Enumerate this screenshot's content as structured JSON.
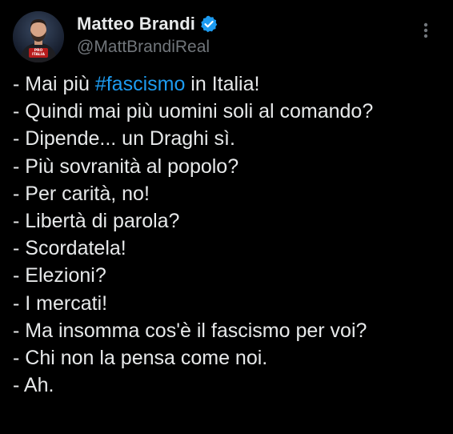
{
  "author": {
    "display_name": "Matteo Brandi",
    "handle": "@MattBrandiReal",
    "verified": true,
    "avatar_badge_text": "PRO ITALIA",
    "icons": {
      "verified": "verified-badge-icon",
      "more": "more-options-icon"
    }
  },
  "tweet": {
    "line1": {
      "prefix": "- Mai più ",
      "hashtag": "#fascismo",
      "suffix": " in Italia!"
    },
    "lines": [
      "- Quindi mai più uomini soli al comando?",
      "- Dipende... un Draghi sì.",
      "- Più sovranità al popolo?",
      "- Per carità, no!",
      "- Libertà di parola?",
      "- Scordatela!",
      "- Elezioni?",
      "- I mercati!",
      "- Ma insomma cos'è il fascismo per voi?",
      "- Chi non la pensa come noi.",
      "- Ah."
    ]
  },
  "colors": {
    "background": "#000000",
    "text": "#e7e9ea",
    "secondary": "#71767b",
    "accent": "#1d9bf0"
  }
}
